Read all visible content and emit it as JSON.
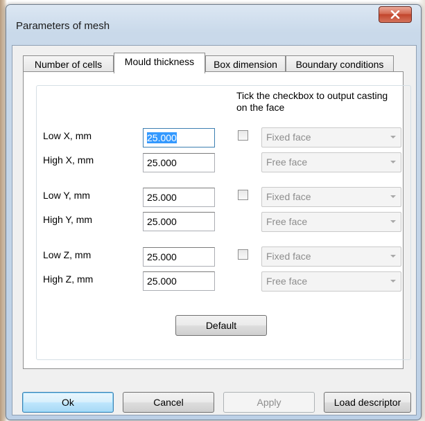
{
  "window": {
    "title": "Parameters of mesh",
    "close_glyph": "X"
  },
  "tabs": [
    {
      "label": "Number of cells"
    },
    {
      "label": "Mould thickness"
    },
    {
      "label": "Box dimension"
    },
    {
      "label": "Boundary conditions"
    }
  ],
  "active_tab": "Mould thickness",
  "panel": {
    "hint": "Tick the checkbox to output casting on the face",
    "rows": [
      {
        "label": "Low X, mm",
        "value": "25.000",
        "checked": false,
        "face": "Fixed face"
      },
      {
        "label": "High X, mm",
        "value": "25.000",
        "face": "Free face"
      },
      {
        "label": "Low Y, mm",
        "value": "25.000",
        "checked": false,
        "face": "Fixed face"
      },
      {
        "label": "High Y, mm",
        "value": "25.000",
        "face": "Free face"
      },
      {
        "label": "Low Z, mm",
        "value": "25.000",
        "checked": false,
        "face": "Fixed face"
      },
      {
        "label": "High Z, mm",
        "value": "25.000",
        "face": "Free face"
      }
    ],
    "default_button": "Default"
  },
  "footer": {
    "ok": "Ok",
    "cancel": "Cancel",
    "apply": "Apply",
    "load_descriptor": "Load descriptor"
  },
  "colors": {
    "accent_selection": "#3399ff",
    "close_button": "#c2452c"
  }
}
